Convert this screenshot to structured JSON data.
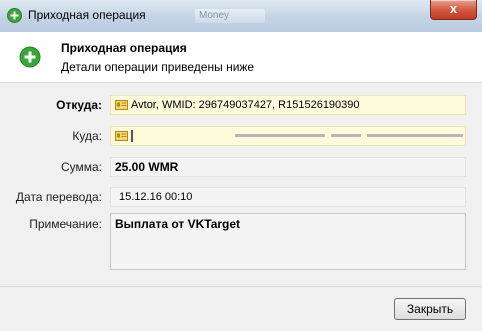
{
  "window": {
    "title": "Приходная операция",
    "close_glyph": "x",
    "ghost_tab": "Money"
  },
  "header": {
    "title": "Приходная операция",
    "subtitle": "Детали операции приведены ниже",
    "icon": "plus-circle-icon",
    "icon_color": "#3aa63a"
  },
  "form": {
    "from_label": "Откуда:",
    "from_value": "Avtor, WMID: 296749037427, R151526190390",
    "from_icon": "id-card-icon",
    "to_label": "Куда:",
    "to_icon": "id-card-icon",
    "amount_label": "Сумма:",
    "amount_value": "25.00 WMR",
    "date_label": "Дата перевода:",
    "date_value": "15.12.16 00:10",
    "note_label": "Примечание:",
    "note_value": "Выплата от VKTarget"
  },
  "footer": {
    "close_button": "Закрыть"
  },
  "colors": {
    "field_highlight": "#fdfbdc",
    "close_red": "#c23b23"
  }
}
